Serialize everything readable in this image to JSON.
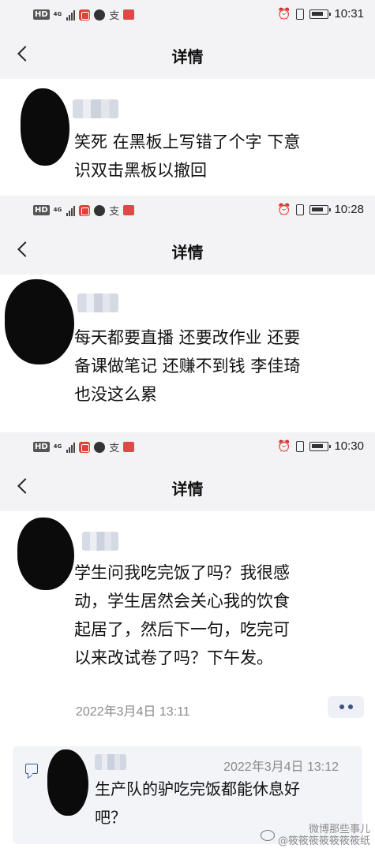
{
  "nav_title": "详情",
  "screens": [
    {
      "time": "10:31",
      "post_lines": [
        "笑死 在黑板上写错了个字  下意",
        "识双击黑板以撤回"
      ]
    },
    {
      "time": "10:28",
      "post_lines": [
        "每天都要直播 还要改作业 还要",
        "备课做笔记 还赚不到钱 李佳琦",
        "也没这么累"
      ]
    },
    {
      "time": "10:30",
      "post_lines": [
        "学生问我吃完饭了吗？我很感",
        "动，学生居然会关心我的饮食",
        "起居了，然后下一句，吃完可",
        "以来改试卷了吗？下午发。"
      ],
      "post_date": "2022年3月4日 13:11",
      "reply": {
        "date": "2022年3月4日 13:12",
        "lines": [
          "生产队的驴吃完饭都能休息好",
          "吧？"
        ]
      }
    }
  ],
  "status_icons": [
    "hd-badge",
    "network-4g",
    "signal-bars",
    "app-icon-red",
    "app-icon-ball",
    "app-icon-text",
    "app-icon-red-2",
    "alarm-icon",
    "vibrate-icon",
    "battery-icon"
  ],
  "app_text_glyph": "支",
  "gen_label": "4G",
  "hd_label": "HD",
  "watermark": {
    "line1": "微博那些事儿",
    "line2": "@筱筱筱筱筱筱筱纸"
  },
  "colors": {
    "bar_bg": "#f3f3f5",
    "accent_blue": "#3b5289",
    "date_gray": "#8a8a8a",
    "reply_bg": "#f3f4f8"
  }
}
